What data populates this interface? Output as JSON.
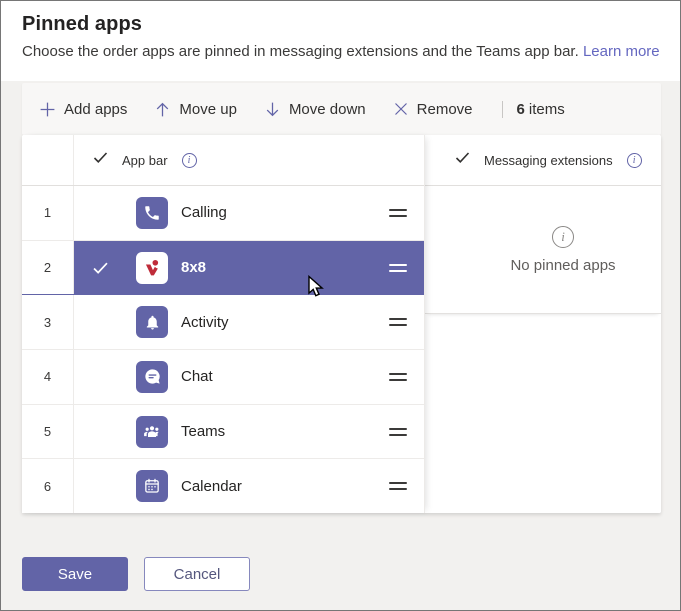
{
  "header": {
    "title": "Pinned apps",
    "subtitle": "Choose the order apps are pinned in messaging extensions and the Teams app bar.",
    "learn_more_label": "Learn more"
  },
  "toolbar": {
    "buttons": [
      {
        "label": "Add apps",
        "icon": "add-apps-plus-icon"
      },
      {
        "label": "Move up",
        "icon": "move-up-arrow-icon"
      },
      {
        "label": "Move down",
        "icon": "move-down-arrow-icon"
      },
      {
        "label": "Remove",
        "icon": "remove-x-icon"
      }
    ],
    "item_count": "6",
    "item_count_label": "items"
  },
  "table": {
    "app_bar_column": {
      "label": "App bar"
    },
    "messaging_column": {
      "label": "Messaging extensions"
    },
    "rows": [
      {
        "num": "1",
        "name": "Calling",
        "icon": "calling-app-icon",
        "selected": false
      },
      {
        "num": "2",
        "name": "8x8",
        "icon": "8x8-app-icon",
        "selected": true
      },
      {
        "num": "3",
        "name": "Activity",
        "icon": "activity-app-icon",
        "selected": false
      },
      {
        "num": "4",
        "name": "Chat",
        "icon": "chat-app-icon",
        "selected": false
      },
      {
        "num": "5",
        "name": "Teams",
        "icon": "teams-app-icon",
        "selected": false
      },
      {
        "num": "6",
        "name": "Calendar",
        "icon": "calendar-app-icon",
        "selected": false
      }
    ],
    "empty_state_text": "No pinned apps"
  },
  "footer": {
    "save_label": "Save",
    "cancel_label": "Cancel"
  },
  "colors": {
    "accent": "#6264a7",
    "selected_row": "#6264a7",
    "link": "#6467c0",
    "logo_red": "#bf2c3a",
    "page_backdrop": "#f2f1ef"
  }
}
